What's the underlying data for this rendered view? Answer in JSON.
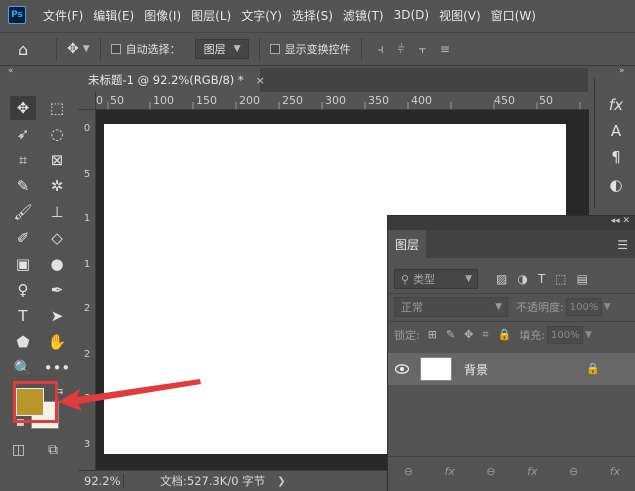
{
  "app": {
    "logo_text": "Ps",
    "menus": [
      "文件(F)",
      "编辑(E)",
      "图像(I)",
      "图层(L)",
      "文字(Y)",
      "选择(S)",
      "滤镜(T)",
      "3D(D)",
      "视图(V)",
      "窗口(W)"
    ],
    "window_controls": {
      "minimize": "—",
      "maximize": "☐",
      "close": "✕"
    }
  },
  "options_bar": {
    "auto_select_label": "自动选择：",
    "auto_select_target": "图层",
    "show_transform_label": "显示变换控件"
  },
  "document": {
    "tab_title": "未标题-1 @ 92.2%(RGB/8) *",
    "close_glyph": "×",
    "ruler_h": [
      "0",
      "50",
      "100",
      "150",
      "200",
      "250",
      "300",
      "350",
      "400",
      "450",
      "50"
    ],
    "ruler_v": [
      "0",
      "5",
      "1",
      "1",
      "2",
      "2",
      "3",
      "3"
    ],
    "zoom": "92.2%",
    "doc_info": "文档:527.3K/0 字节"
  },
  "colors": {
    "foreground": "#b8962a",
    "background": "#f5f2e6",
    "annotation": "#e23b3b"
  },
  "layers_panel": {
    "tab_label": "图层",
    "filter_kind": "类型",
    "blend_mode": "正常",
    "opacity_label": "不透明度:",
    "opacity_value": "100%",
    "lock_label": "锁定:",
    "fill_label": "填充:",
    "fill_value": "100%",
    "layers": [
      {
        "name": "背景",
        "visible": true,
        "locked": true
      }
    ],
    "footer_icons": [
      "link-icon",
      "fx-icon",
      "link-icon",
      "fx-icon",
      "link-icon",
      "fx-icon"
    ],
    "fx_label": "fx"
  },
  "right_strip": {
    "icons": [
      "fx-icon",
      "character-icon",
      "paragraph-icon",
      "adjustments-icon"
    ],
    "fx_label": "fx",
    "character_label": "A",
    "paragraph_label": "¶"
  }
}
